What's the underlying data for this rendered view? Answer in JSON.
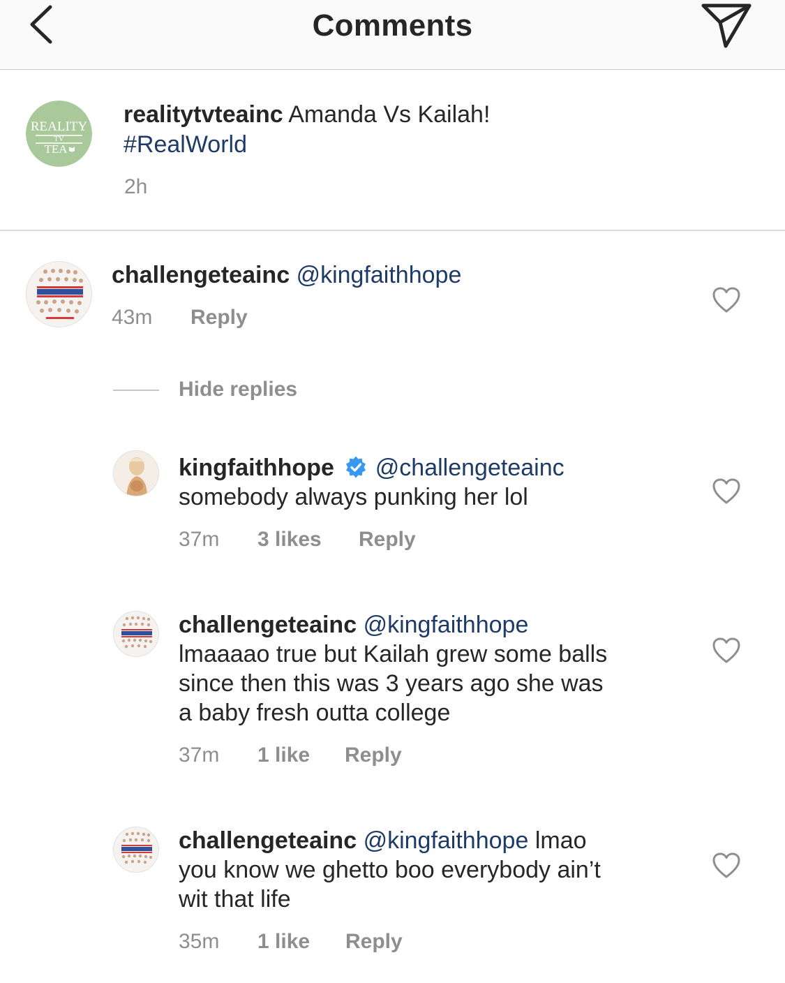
{
  "header": {
    "title": "Comments",
    "back_icon": "chevron-left-icon",
    "share_icon": "paper-plane-icon"
  },
  "caption": {
    "username": "realitytvteainc",
    "text": "Amanda Vs Kailah!",
    "hashtag": "#RealWorld",
    "time": "2h",
    "avatar_text": "REALITY TV TEA",
    "avatar_color": "#a9c99b"
  },
  "comments": [
    {
      "username": "challengeteainc",
      "mention": "@kingfaithhope",
      "text": "",
      "time": "43m",
      "likes": "",
      "reply_label": "Reply"
    }
  ],
  "hide_replies_label": "Hide replies",
  "replies": [
    {
      "username": "kingfaithhope",
      "verified": true,
      "mention": "@challengeteainc",
      "line1": "somebody always punking her lol",
      "time": "37m",
      "likes": "3 likes",
      "reply_label": "Reply"
    },
    {
      "username": "challengeteainc",
      "mention": "@kingfaithhope",
      "line1": "lmaaaao true but Kailah grew some balls",
      "line2": "since then this was 3 years ago she was",
      "line3": "a baby fresh outta college",
      "time": "37m",
      "likes": "1 like",
      "reply_label": "Reply"
    },
    {
      "username": "challengeteainc",
      "mention": "@kingfaithhope",
      "inline_text": "lmao",
      "line1": "you know we ghetto boo everybody ain’t",
      "line2": "wit that life",
      "time": "35m",
      "likes": "1 like",
      "reply_label": "Reply"
    }
  ],
  "colors": {
    "link": "#1d3b66",
    "meta_gray": "#8e8e8e",
    "verified_blue": "#3897f0"
  }
}
